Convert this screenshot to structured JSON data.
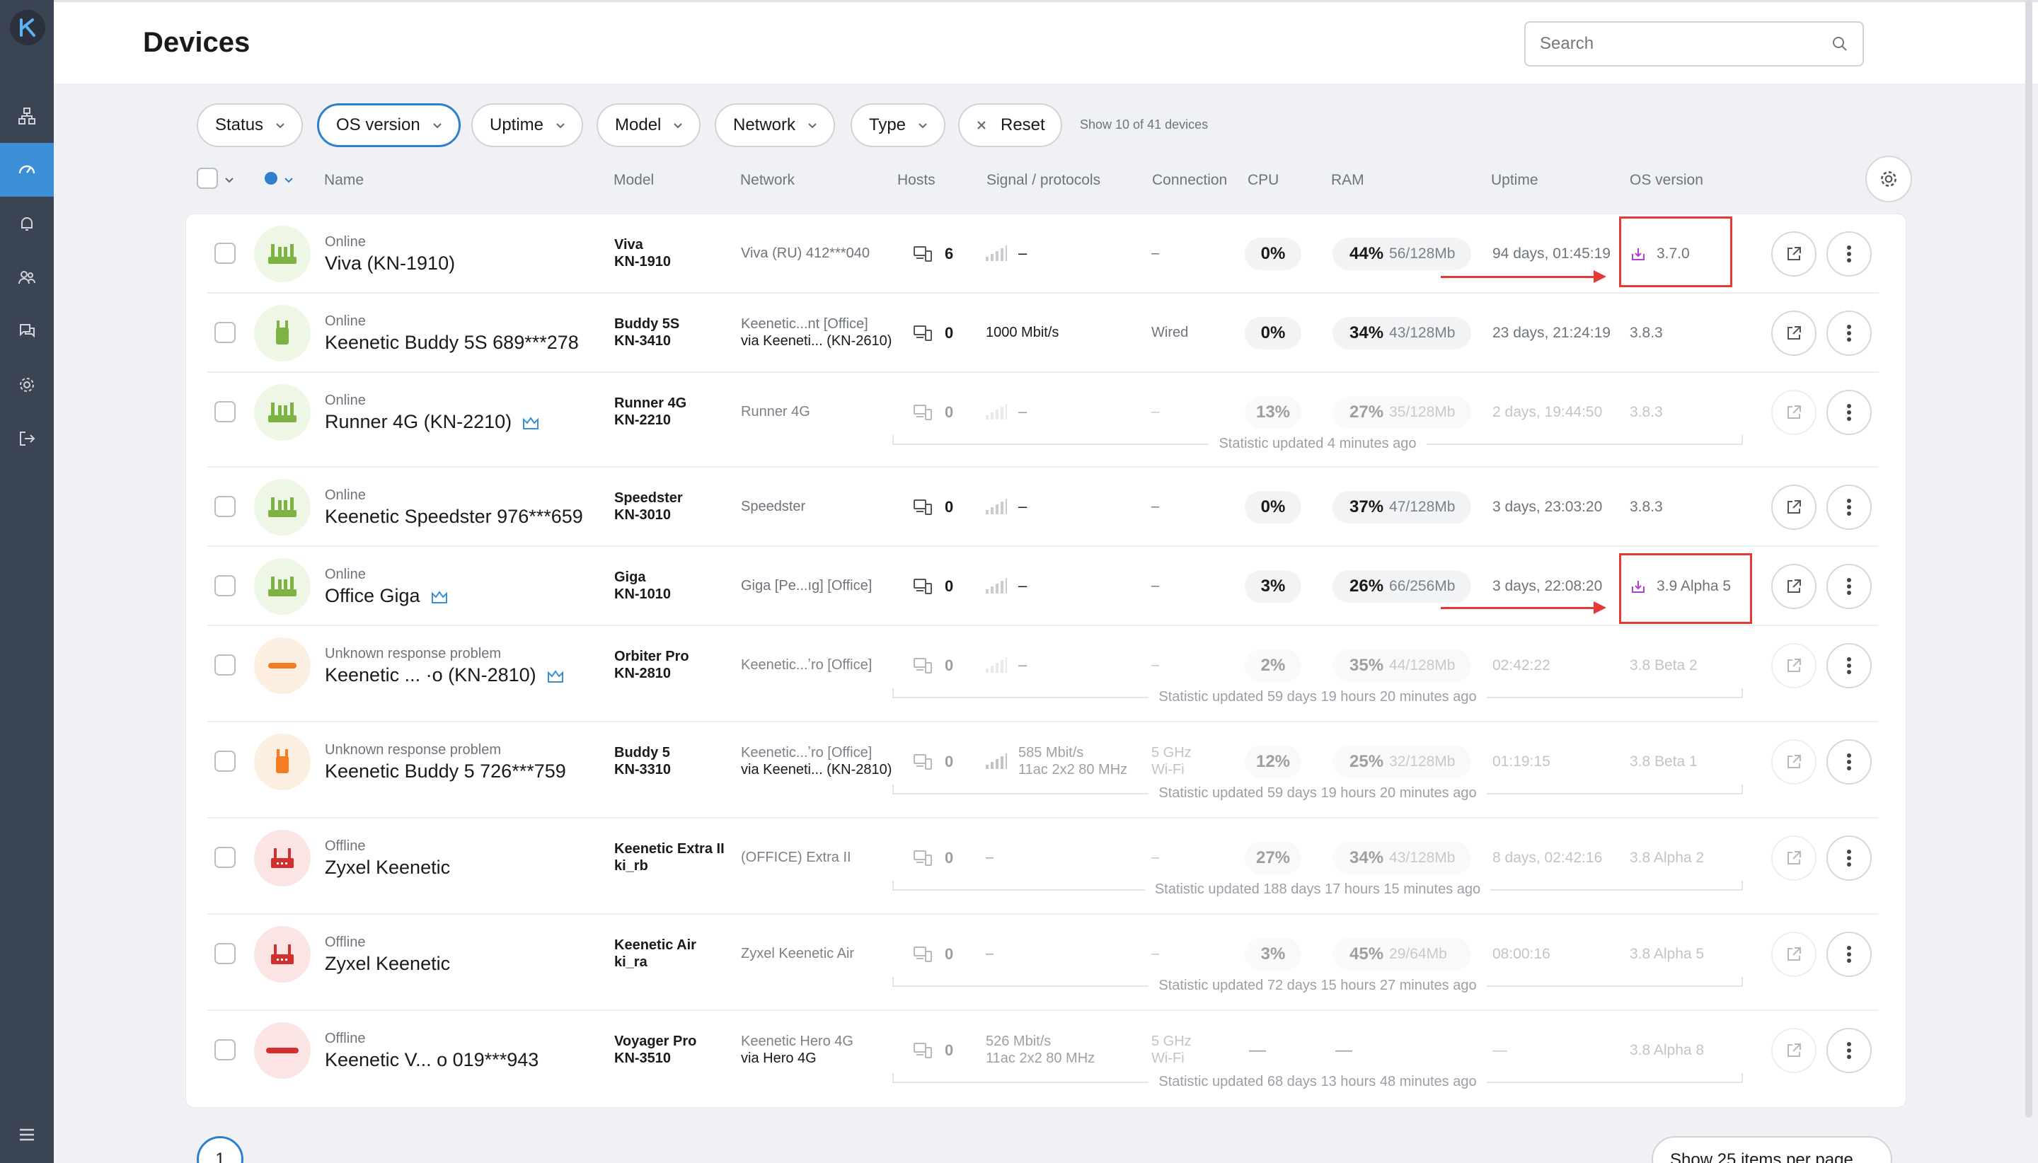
{
  "header": {
    "title": "Devices",
    "search_placeholder": "Search"
  },
  "filters": [
    {
      "label": "Status"
    },
    {
      "label": "OS version",
      "active": true
    },
    {
      "label": "Uptime"
    },
    {
      "label": "Model"
    },
    {
      "label": "Network"
    },
    {
      "label": "Type"
    }
  ],
  "reset_label": "Reset",
  "show_count": "Show 10 of 41 devices",
  "columns": {
    "name": "Name",
    "model": "Model",
    "network": "Network",
    "hosts": "Hosts",
    "signal": "Signal / protocols",
    "connection": "Connection",
    "cpu": "CPU",
    "ram": "RAM",
    "uptime": "Uptime",
    "os": "OS version"
  },
  "colors": {
    "accent": "#2f7fcc",
    "sidebar": "#3b4452",
    "online": "#7cb342",
    "warning": "#f57c22",
    "offline": "#d32f2f",
    "update": "#b03fcf",
    "highlight": "#e53935"
  },
  "devices": [
    {
      "status": "Online",
      "name": "Viva (KN-1910)",
      "model1": "Viva",
      "model2": "KN-1910",
      "net1": "Viva (RU) 412***040",
      "net2": "",
      "hosts": "6",
      "signal": "–",
      "connection": "–",
      "cpu": "0%",
      "ram_used": "44%",
      "ram_total": "56/128Mb",
      "uptime": "94 days, 01:45:19",
      "os": "3.7.0",
      "state": "online",
      "update": true,
      "crown": false,
      "stat": ""
    },
    {
      "status": "Online",
      "name": "Keenetic Buddy 5S 689***278",
      "model1": "Buddy 5S",
      "model2": "KN-3410",
      "net1": "Keenetic...nt [Office]",
      "net2": "via Keeneti...  (KN-2610)",
      "hosts": "0",
      "signal": "1000 Mbit/s",
      "connection": "Wired",
      "cpu": "0%",
      "ram_used": "34%",
      "ram_total": "43/128Mb",
      "uptime": "23 days, 21:24:19",
      "os": "3.8.3",
      "state": "online",
      "update": false,
      "crown": false,
      "stat": ""
    },
    {
      "status": "Online",
      "name": "Runner 4G (KN-2210)",
      "model1": "Runner 4G",
      "model2": "KN-2210",
      "net1": "Runner 4G",
      "net2": "",
      "hosts": "0",
      "signal": "–",
      "connection": "–",
      "cpu": "13%",
      "ram_used": "27%",
      "ram_total": "35/128Mb",
      "uptime": "2 days, 19:44:50",
      "os": "3.8.3",
      "state": "online",
      "update": false,
      "crown": true,
      "stat": "Statistic updated 4 minutes ago"
    },
    {
      "status": "Online",
      "name": "Keenetic Speedster 976***659",
      "model1": "Speedster",
      "model2": "KN-3010",
      "net1": "Speedster",
      "net2": "",
      "hosts": "0",
      "signal": "–",
      "connection": "–",
      "cpu": "0%",
      "ram_used": "37%",
      "ram_total": "47/128Mb",
      "uptime": "3 days, 23:03:20",
      "os": "3.8.3",
      "state": "online",
      "update": false,
      "crown": false,
      "stat": ""
    },
    {
      "status": "Online",
      "name": "Office Giga",
      "model1": "Giga",
      "model2": "KN-1010",
      "net1": "Giga [Pe...ıg] [Office]",
      "net2": "",
      "hosts": "0",
      "signal": "–",
      "connection": "–",
      "cpu": "3%",
      "ram_used": "26%",
      "ram_total": "66/256Mb",
      "uptime": "3 days, 22:08:20",
      "os": "3.9 Alpha 5",
      "state": "online",
      "update": true,
      "crown": true,
      "stat": ""
    },
    {
      "status": "Unknown response problem",
      "name": "Keenetic ...  ·o (KN-2810)",
      "model1": "Orbiter Pro",
      "model2": "KN-2810",
      "net1": "Keenetic...ʼro [Office]",
      "net2": "",
      "hosts": "0",
      "signal": "–",
      "connection": "–",
      "cpu": "2%",
      "ram_used": "35%",
      "ram_total": "44/128Mb",
      "uptime": "02:42:22",
      "os": "3.8 Beta 2",
      "state": "warning",
      "update": false,
      "crown": true,
      "stat": "Statistic updated 59 days 19 hours 20 minutes ago"
    },
    {
      "status": "Unknown response problem",
      "name": "Keenetic Buddy 5 726***759",
      "model1": "Buddy 5",
      "model2": "KN-3310",
      "net1": "Keenetic...ʼro [Office]",
      "net2": "via Keeneti...  (KN-2810)",
      "hosts": "0",
      "signal": "585 Mbit/s",
      "signal2": "11ac 2x2 80 MHz",
      "connection": "5 GHz",
      "connection2": "Wi-Fi",
      "cpu": "12%",
      "ram_used": "25%",
      "ram_total": "32/128Mb",
      "uptime": "01:19:15",
      "os": "3.8 Beta 1",
      "state": "warning",
      "update": false,
      "crown": false,
      "stat": "Statistic updated 59 days 19 hours 20 minutes ago"
    },
    {
      "status": "Offline",
      "name": "Zyxel Keenetic",
      "model1": "Keenetic Extra II",
      "model2": "ki_rb",
      "net1": "(OFFICE) Extra II",
      "net2": "",
      "hosts": "0",
      "signal": "–",
      "connection": "–",
      "cpu": "27%",
      "ram_used": "34%",
      "ram_total": "43/128Mb",
      "uptime": "8 days, 02:42:16",
      "os": "3.8 Alpha 2",
      "state": "offline",
      "update": false,
      "crown": false,
      "stat": "Statistic updated 188 days 17 hours 15 minutes ago"
    },
    {
      "status": "Offline",
      "name": "Zyxel Keenetic",
      "model1": "Keenetic Air",
      "model2": "ki_ra",
      "net1": "Zyxel Keenetic Air",
      "net2": "",
      "hosts": "0",
      "signal": "–",
      "connection": "–",
      "cpu": "3%",
      "ram_used": "45%",
      "ram_total": "29/64Mb",
      "uptime": "08:00:16",
      "os": "3.8 Alpha 5",
      "state": "offline",
      "update": false,
      "crown": false,
      "stat": "Statistic updated 72 days 15 hours 27 minutes ago"
    },
    {
      "status": "Offline",
      "name": "Keenetic V...  o 019***943",
      "model1": "Voyager Pro",
      "model2": "KN-3510",
      "net1": "Keenetic Hero 4G",
      "net2": "via Hero 4G",
      "hosts": "0",
      "signal": "526 Mbit/s",
      "signal2": "11ac 2x2 80 MHz",
      "connection": "5 GHz",
      "connection2": "Wi-Fi",
      "cpu": "—",
      "ram_used": "—",
      "ram_total": "",
      "uptime": "—",
      "os": "3.8 Alpha 8",
      "state": "offline",
      "update": false,
      "crown": false,
      "stat": "Statistic updated 68 days 13 hours 48 minutes ago"
    }
  ],
  "pagination": {
    "current": "1",
    "per_page": "Show 25 items per page"
  }
}
